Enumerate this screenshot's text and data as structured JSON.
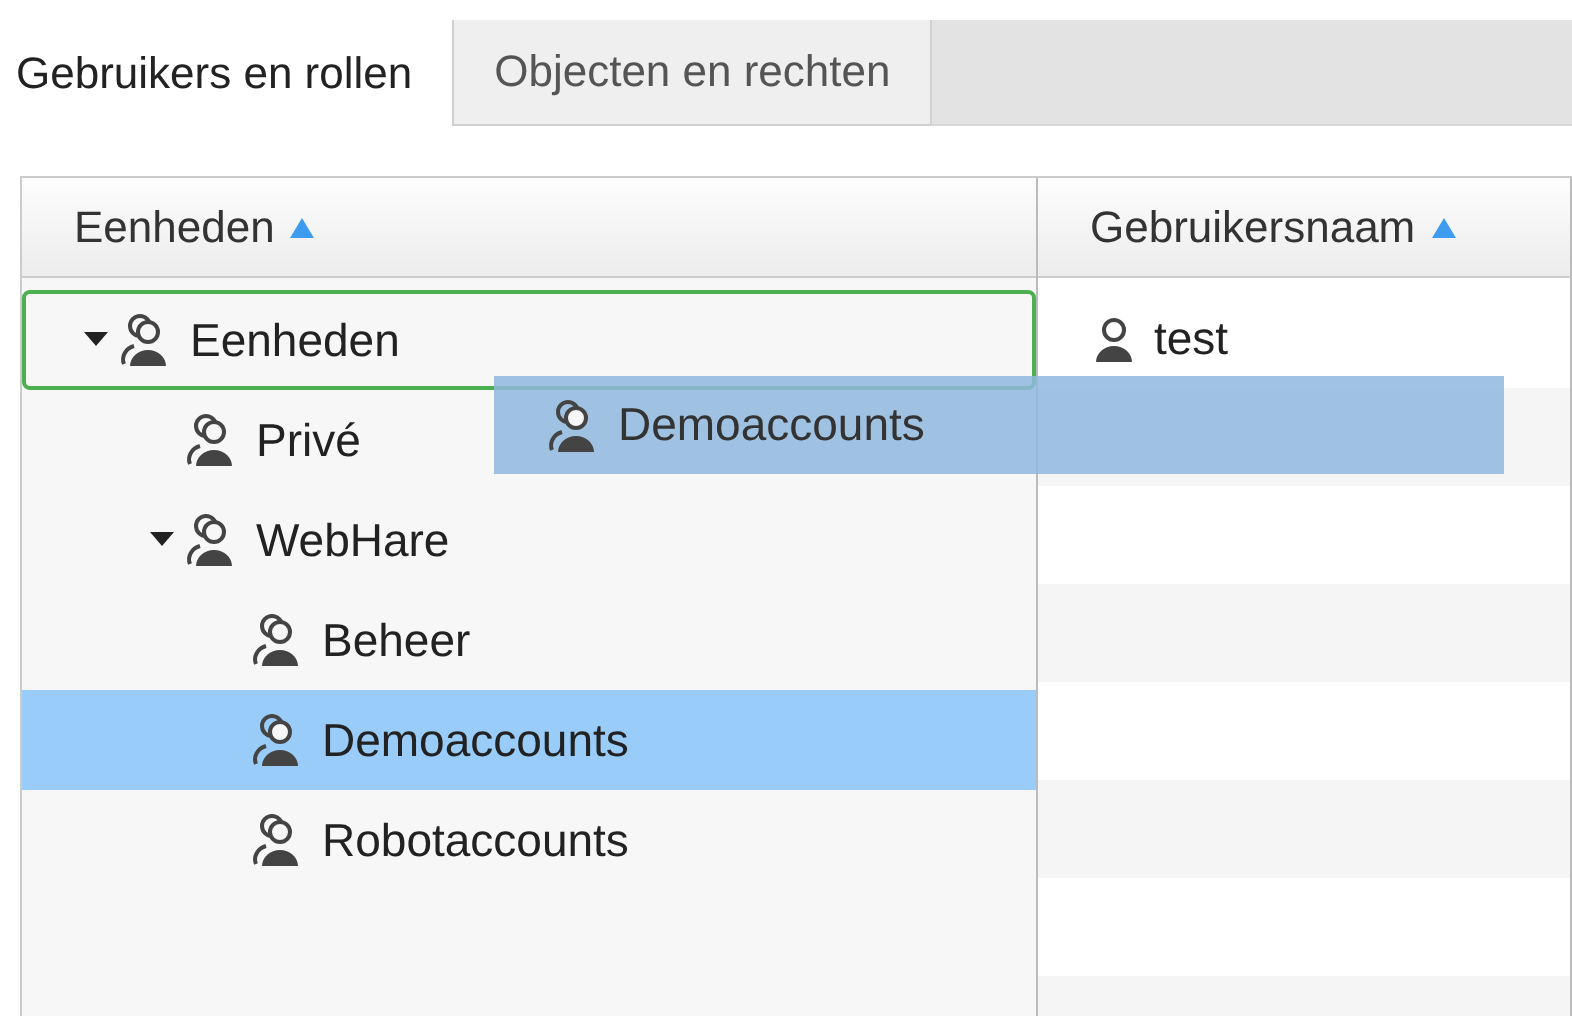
{
  "tabs": [
    {
      "label": "Gebruikers en rollen",
      "selected": true
    },
    {
      "label": "Objecten en rechten",
      "selected": false
    }
  ],
  "units_column": {
    "label": "Eenheden",
    "sorted": true
  },
  "tree": [
    {
      "label": "Eenheden",
      "expanded": true,
      "selected": false,
      "drop_target": true,
      "children": [
        {
          "label": "Privé",
          "selected": false,
          "drop_target": false
        },
        {
          "label": "WebHare",
          "expanded": true,
          "selected": false,
          "drop_target": false,
          "children": [
            {
              "label": "Beheer",
              "selected": false,
              "drop_target": false
            },
            {
              "label": "Demoaccounts",
              "selected": true,
              "drop_target": false
            },
            {
              "label": "Robotaccounts",
              "selected": false,
              "drop_target": false
            }
          ]
        }
      ]
    }
  ],
  "users_column": {
    "label": "Gebruikersnaam",
    "sorted": true
  },
  "users": [
    {
      "name": "test"
    }
  ],
  "drag_ghost": {
    "label": "Demoaccounts"
  }
}
